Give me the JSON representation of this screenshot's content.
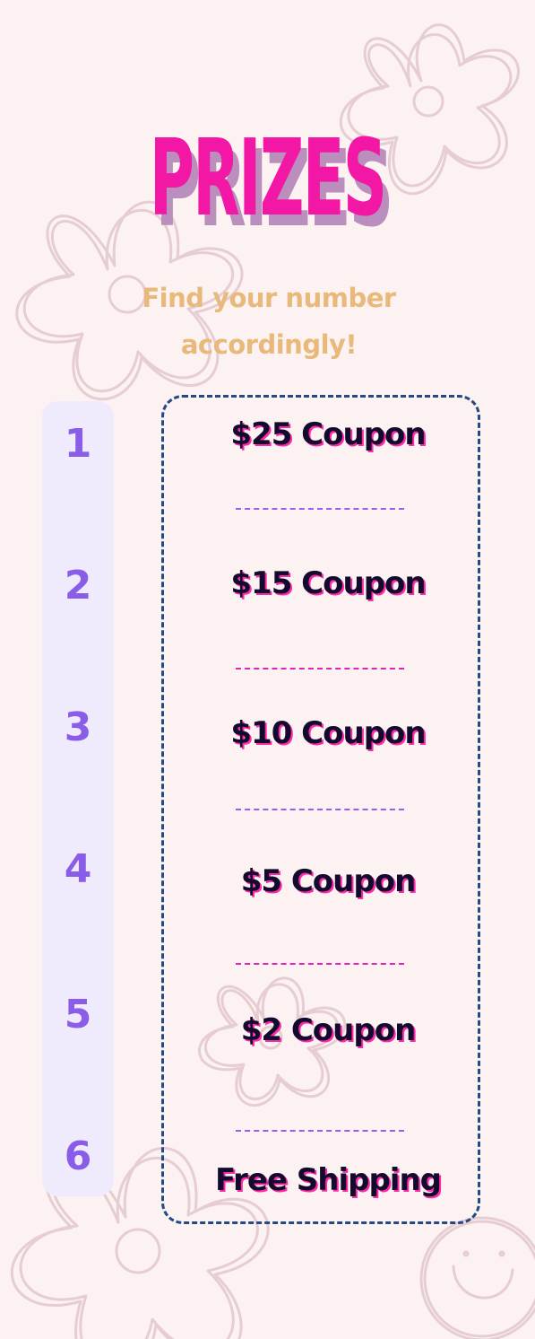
{
  "title": "PRIZES",
  "subtitle_line1": "Find your number",
  "subtitle_line2": "accordingly!",
  "numbers": [
    "1",
    "2",
    "3",
    "4",
    "5",
    "6"
  ],
  "prizes": [
    "$25 Coupon",
    "$15 Coupon",
    "$10 Coupon",
    "$5 Coupon",
    "$2 Coupon",
    "Free Shipping"
  ],
  "colors": {
    "background": "#fcf2f1",
    "title": "#f217a4",
    "title_shadow": "#bb8fbd",
    "subtitle": "#e8b97a",
    "numbers": "#8a5de8",
    "number_column": "#efeafc",
    "box_border": "#244a86",
    "prize_text": "#130b2e",
    "separator_purple": "#9a5cf0",
    "separator_pink": "#e223b6"
  },
  "decorations": [
    "flower-outline-icon",
    "smiley-face-icon"
  ]
}
